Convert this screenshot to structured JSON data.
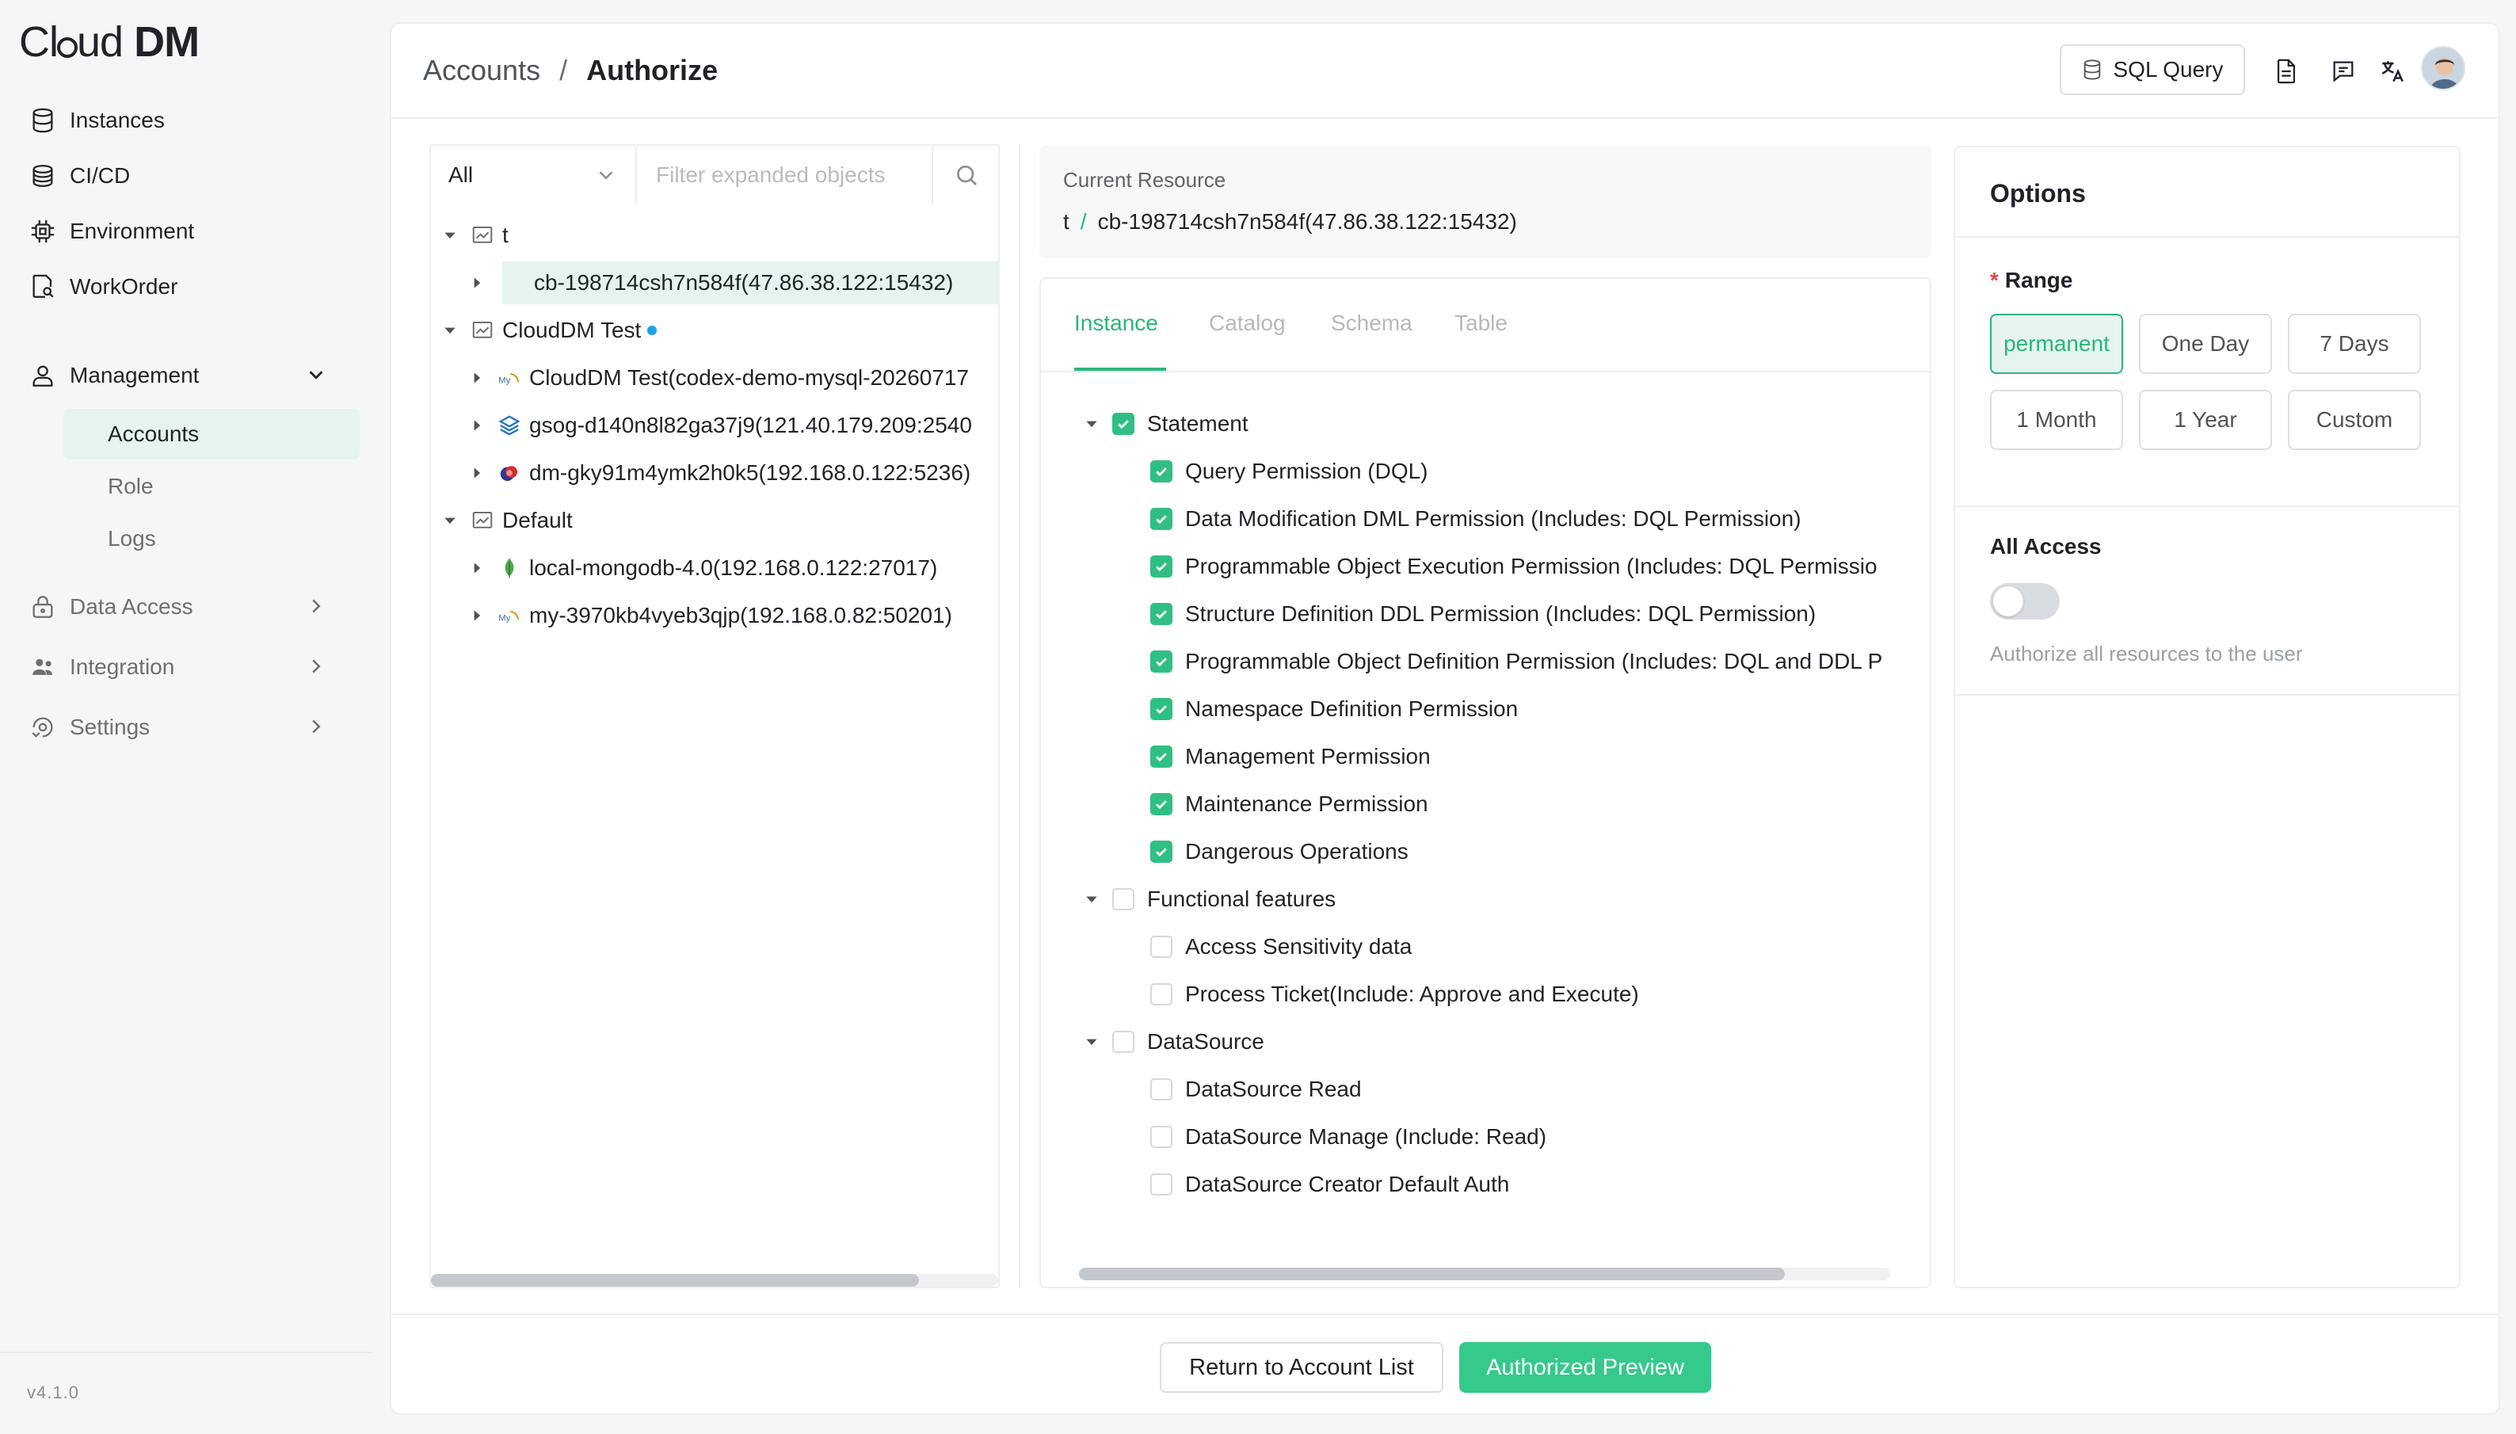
{
  "app": {
    "logo_text_a": "Cl",
    "logo_text_b": "ud ",
    "logo_text_c": "DM",
    "version": "v4.1.0"
  },
  "sidebar": {
    "items": [
      {
        "label": "Instances",
        "icon": "database-icon"
      },
      {
        "label": "CI/CD",
        "icon": "stack-icon"
      },
      {
        "label": "Environment",
        "icon": "chip-icon"
      },
      {
        "label": "WorkOrder",
        "icon": "document-search-icon"
      },
      {
        "label": "Management",
        "icon": "user-icon"
      },
      {
        "label": "Data Access",
        "icon": "lock-icon"
      },
      {
        "label": "Integration",
        "icon": "team-icon"
      },
      {
        "label": "Settings",
        "icon": "settings-icon"
      }
    ],
    "sub_items": [
      {
        "label": "Accounts"
      },
      {
        "label": "Role"
      },
      {
        "label": "Logs"
      }
    ]
  },
  "header": {
    "breadcrumb_parent": "Accounts",
    "breadcrumb_sep": "/",
    "breadcrumb_current": "Authorize",
    "sql_query_label": "SQL Query"
  },
  "tree": {
    "filter_value": "All",
    "search_placeholder": "Filter expanded objects",
    "nodes": [
      {
        "label": "t"
      },
      {
        "label": "cb-198714csh7n584f(47.86.38.122:15432)"
      },
      {
        "label": "CloudDM Test"
      },
      {
        "label": "CloudDM Test(codex-demo-mysql-20260717"
      },
      {
        "label": "gsog-d140n8l82ga37j9(121.40.179.209:2540"
      },
      {
        "label": "dm-gky91m4ymk2h0k5(192.168.0.122:5236)"
      },
      {
        "label": "Default"
      },
      {
        "label": "local-mongodb-4.0(192.168.0.122:27017)"
      },
      {
        "label": "my-3970kb4vyeb3qjp(192.168.0.82:50201)"
      }
    ],
    "scroll_fraction": 0.86
  },
  "resource": {
    "label": "Current Resource",
    "path_root": "t",
    "path_sep": "/",
    "path_leaf": "cb-198714csh7n584f(47.86.38.122:15432)"
  },
  "tabs": [
    "Instance",
    "Catalog",
    "Schema",
    "Table"
  ],
  "permissions": {
    "groups": [
      {
        "label": "Statement",
        "checked": true,
        "items": [
          {
            "label": "Query Permission (DQL)",
            "checked": true
          },
          {
            "label": "Data Modification DML Permission (Includes: DQL Permission)",
            "checked": true
          },
          {
            "label": "Programmable Object Execution Permission (Includes: DQL Permissio",
            "checked": true
          },
          {
            "label": "Structure Definition DDL Permission (Includes: DQL Permission)",
            "checked": true
          },
          {
            "label": "Programmable Object Definition Permission (Includes: DQL and DDL P",
            "checked": true
          },
          {
            "label": "Namespace Definition Permission",
            "checked": true
          },
          {
            "label": "Management Permission",
            "checked": true
          },
          {
            "label": "Maintenance Permission",
            "checked": true
          },
          {
            "label": "Dangerous Operations",
            "checked": true
          }
        ]
      },
      {
        "label": "Functional features",
        "checked": false,
        "items": [
          {
            "label": "Access Sensitivity data",
            "checked": false
          },
          {
            "label": "Process Ticket(Include: Approve and Execute)",
            "checked": false
          }
        ]
      },
      {
        "label": "DataSource",
        "checked": false,
        "items": [
          {
            "label": "DataSource Read",
            "checked": false
          },
          {
            "label": "DataSource Manage (Include: Read)",
            "checked": false
          },
          {
            "label": "DataSource Creator Default Auth",
            "checked": false
          }
        ]
      }
    ],
    "scroll_fraction": 0.87
  },
  "options": {
    "title": "Options",
    "range_required_mark": "*",
    "range_label": "Range",
    "range_options": [
      "permanent",
      "One Day",
      "7 Days",
      "1 Month",
      "1 Year",
      "Custom"
    ],
    "range_selected": "permanent",
    "all_access_label": "All Access",
    "all_access_on": false,
    "all_access_hint": "Authorize all resources to the user"
  },
  "footer": {
    "return_label": "Return to Account List",
    "preview_label": "Authorized Preview"
  },
  "colors": {
    "accent": "#2bb57a",
    "accent_button": "#35c98b",
    "accent_bg": "#e5f4ee",
    "status_dot": "#1aa3e8"
  }
}
